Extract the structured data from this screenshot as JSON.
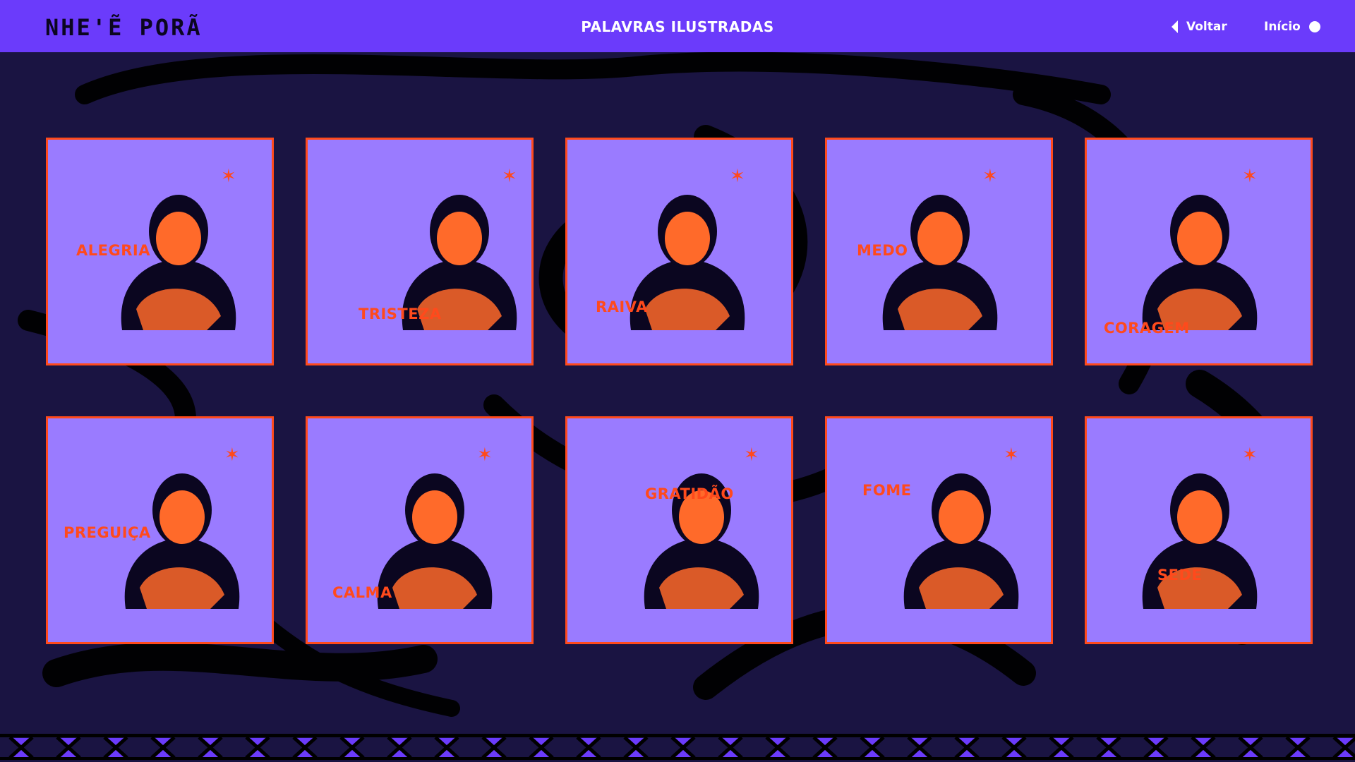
{
  "header": {
    "logo": "NHE'Ẽ PORÃ",
    "title": "PALAVRAS ILUSTRADAS",
    "back_label": "Voltar",
    "home_label": "Início"
  },
  "cards": [
    {
      "label": "ALEGRIA"
    },
    {
      "label": "TRISTEZA"
    },
    {
      "label": "RAIVA"
    },
    {
      "label": "MEDO"
    },
    {
      "label": "CORAGEM"
    },
    {
      "label": "PREGUIÇA"
    },
    {
      "label": "CALMA"
    },
    {
      "label": "GRATIDÃO"
    },
    {
      "label": "FOME"
    },
    {
      "label": "SEDE"
    }
  ],
  "colors": {
    "header": "#6b3bfb",
    "background": "#1a1442",
    "card": "#9a7bff",
    "accent": "#ff4a1c"
  }
}
